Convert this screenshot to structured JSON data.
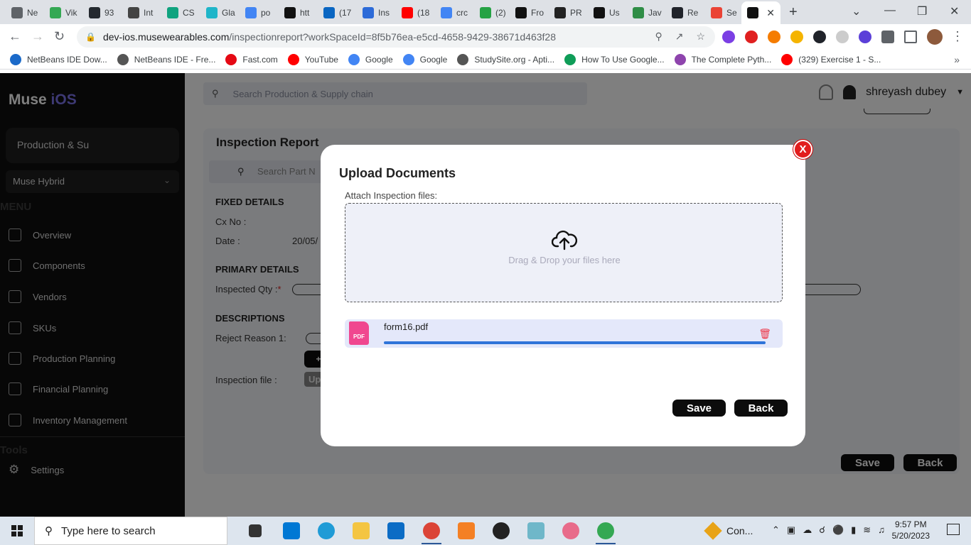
{
  "browser": {
    "tabs": [
      {
        "label": "Ne",
        "color": "#5f6368"
      },
      {
        "label": "Vik",
        "color": "#34a853"
      },
      {
        "label": "93",
        "color": "#24292f"
      },
      {
        "label": "Int",
        "color": "#444"
      },
      {
        "label": "CS",
        "color": "#10a37f"
      },
      {
        "label": "Gla",
        "color": "#1fb5c9"
      },
      {
        "label": "po",
        "color": "#4285f4"
      },
      {
        "label": "htt",
        "color": "#111"
      },
      {
        "label": "(17",
        "color": "#0a66c2"
      },
      {
        "label": "Ins",
        "color": "#2d6bd8"
      },
      {
        "label": "(18",
        "color": "#ff0000"
      },
      {
        "label": "crc",
        "color": "#4285f4"
      },
      {
        "label": "(2)",
        "color": "#25a244"
      },
      {
        "label": "Fro",
        "color": "#111"
      },
      {
        "label": "PR",
        "color": "#222"
      },
      {
        "label": "Us",
        "color": "#111"
      },
      {
        "label": "Jav",
        "color": "#2f8d46"
      },
      {
        "label": "Re",
        "color": "#20232a"
      },
      {
        "label": "Se",
        "color": "#ea4335"
      },
      {
        "label": "",
        "color": "#111"
      }
    ],
    "url_host": "dev-ios.musewearables.com",
    "url_path": "/inspectionreport?workSpaceId=8f5b76ea-e5cd-4658-9429-38671d463f28",
    "bookmarks": [
      {
        "label": "NetBeans IDE Dow...",
        "color": "#1b6ac9"
      },
      {
        "label": "NetBeans IDE - Fre...",
        "color": "#555"
      },
      {
        "label": "Fast.com",
        "color": "#e50914"
      },
      {
        "label": "YouTube",
        "color": "#ff0000"
      },
      {
        "label": "Google",
        "color": "#4285f4"
      },
      {
        "label": "Google",
        "color": "#4285f4"
      },
      {
        "label": "StudySite.org - Apti...",
        "color": "#555"
      },
      {
        "label": "How To Use Google...",
        "color": "#0f9d58"
      },
      {
        "label": "The Complete Pyth...",
        "color": "#8e44ad"
      },
      {
        "label": "(329) Exercise 1 - S...",
        "color": "#ff0000"
      }
    ]
  },
  "sidebar": {
    "logo_main": "Muse",
    "logo_accent": "iOS",
    "workspace": "Production & Su",
    "product": "Muse Hybrid",
    "menu_heading": "MENU",
    "items": [
      {
        "label": "Overview",
        "icon": "grid-icon"
      },
      {
        "label": "Components",
        "icon": "chip-icon"
      },
      {
        "label": "Vendors",
        "icon": "boxes-icon"
      },
      {
        "label": "SKUs",
        "icon": "star-icon"
      },
      {
        "label": "Production Planning",
        "icon": "trident-icon"
      },
      {
        "label": "Financial Planning",
        "icon": "coins-icon"
      },
      {
        "label": "Inventory Management",
        "icon": "boxes-icon"
      }
    ],
    "tools_heading": "Tools",
    "settings_label": "Settings"
  },
  "header": {
    "search_placeholder": "Search Production & Supply chain",
    "user_name": "shreyash dubey"
  },
  "report": {
    "title": "Inspection Report",
    "search_placeholder": "Search Part N",
    "fixed_details": "FIXED DETAILS",
    "cx_no_label": "Cx No :",
    "date_label": "Date :",
    "date_value": "20/05/",
    "primary_details": "PRIMARY DETAILS",
    "inspected_qty_label": "Inspected Qty :",
    "required_mark": "*",
    "descriptions": "DESCRIPTIONS",
    "reject_reason_label": "Reject Reason 1:",
    "add_label": "+",
    "inspection_file_label": "Inspection file :",
    "upload_btn": "Up",
    "save_label": "Save",
    "back_label": "Back"
  },
  "modal": {
    "title": "Upload Documents",
    "attach_label": "Attach Inspection files:",
    "drop_text": "Drag & Drop your files here",
    "file": {
      "name": "form16.pdf",
      "type_badge": "PDF",
      "progress": 1.0
    },
    "save_label": "Save",
    "back_label": "Back",
    "close_label": "X"
  },
  "taskbar": {
    "search_placeholder": "Type here to search",
    "weather_label": "Con...",
    "time": "9:57 PM",
    "date": "5/20/2023"
  }
}
